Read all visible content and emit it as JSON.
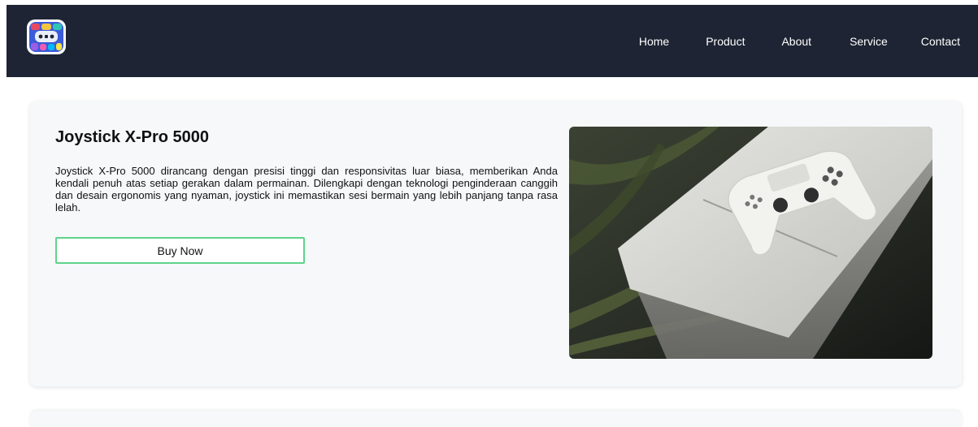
{
  "nav": {
    "logo_icon": "gamepad-collage-logo",
    "links": [
      {
        "label": "Home"
      },
      {
        "label": "Product"
      },
      {
        "label": "About"
      },
      {
        "label": "Service"
      },
      {
        "label": "Contact"
      }
    ]
  },
  "product": {
    "title": "Joystick X-Pro 5000",
    "description": "Joystick X-Pro 5000 dirancang dengan presisi tinggi dan responsivitas luar biasa, memberikan Anda kendali penuh atas setiap gerakan dalam permainan. Dilengkapi dengan teknologi penginderaan canggih dan desain ergonomis yang nyaman, joystick ini memastikan sesi bermain yang lebih panjang tanpa rasa lelah.",
    "buy_label": "Buy Now",
    "image_icon": "white-console-with-controller-photo"
  },
  "colors": {
    "navbar_bg": "#1e2433",
    "card_bg": "#f6f8fa",
    "button_border": "#5fd38b"
  }
}
